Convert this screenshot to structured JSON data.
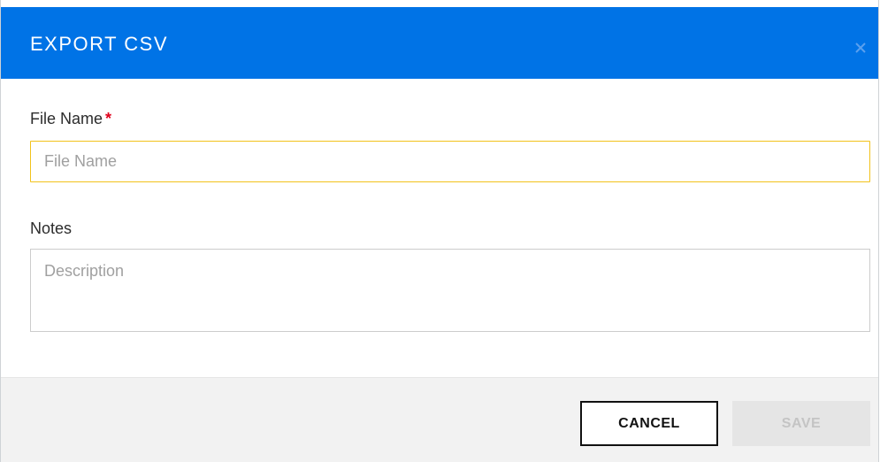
{
  "dialog": {
    "title": "EXPORT CSV",
    "close_icon": "close-icon",
    "header_color": "#0073e6"
  },
  "form": {
    "file_name": {
      "label": "File Name",
      "required_mark": "*",
      "placeholder": "File Name",
      "value": ""
    },
    "notes": {
      "label": "Notes",
      "placeholder": "Description",
      "value": ""
    }
  },
  "footer": {
    "cancel_label": "CANCEL",
    "save_label": "SAVE",
    "save_disabled": true
  }
}
